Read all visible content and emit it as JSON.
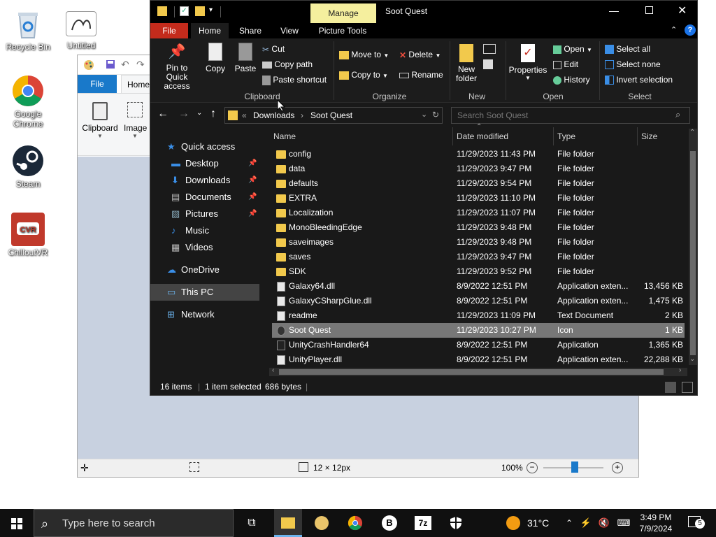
{
  "desktop": {
    "icons": [
      {
        "label": "Recycle Bin"
      },
      {
        "label": "Untitled"
      },
      {
        "label": "Google Chrome"
      },
      {
        "label": "Steam"
      },
      {
        "label": "ChilloutVR"
      }
    ]
  },
  "paint": {
    "tabs": {
      "file": "File",
      "home": "Home"
    },
    "ribbon": {
      "clipboard": "Clipboard",
      "image": "Image"
    },
    "status": {
      "size": "12 × 12px",
      "zoom": "100%"
    }
  },
  "explorer": {
    "title": "Soot Quest",
    "manage_tab": "Manage",
    "tabs": [
      "File",
      "Home",
      "Share",
      "View",
      "Picture Tools"
    ],
    "ribbon": {
      "pin": "Pin to Quick access",
      "copy": "Copy",
      "paste": "Paste",
      "cut": "Cut",
      "copy_path": "Copy path",
      "paste_shortcut": "Paste shortcut",
      "move_to": "Move to",
      "copy_to": "Copy to",
      "delete": "Delete",
      "rename": "Rename",
      "new_folder": "New folder",
      "properties": "Properties",
      "open": "Open",
      "edit": "Edit",
      "history": "History",
      "select_all": "Select all",
      "select_none": "Select none",
      "invert_selection": "Invert selection",
      "groups": [
        "Clipboard",
        "Organize",
        "New",
        "Open",
        "Select"
      ]
    },
    "address": {
      "crumbs": [
        "Downloads",
        "Soot Quest"
      ],
      "search_placeholder": "Search Soot Quest"
    },
    "nav": [
      {
        "label": "Quick access",
        "type": "star"
      },
      {
        "label": "Desktop",
        "type": "desktop",
        "pinned": true
      },
      {
        "label": "Downloads",
        "type": "download",
        "pinned": true
      },
      {
        "label": "Documents",
        "type": "doc",
        "pinned": true
      },
      {
        "label": "Pictures",
        "type": "pic",
        "pinned": true
      },
      {
        "label": "Music",
        "type": "music"
      },
      {
        "label": "Videos",
        "type": "video"
      },
      {
        "label": "OneDrive",
        "type": "cloud"
      },
      {
        "label": "This PC",
        "type": "pc"
      },
      {
        "label": "Network",
        "type": "network"
      }
    ],
    "columns": [
      "Name",
      "Date modified",
      "Type",
      "Size"
    ],
    "files": [
      {
        "name": "config",
        "date": "11/29/2023 11:43 PM",
        "type": "File folder",
        "size": "",
        "kind": "folder"
      },
      {
        "name": "data",
        "date": "11/29/2023 9:47 PM",
        "type": "File folder",
        "size": "",
        "kind": "folder"
      },
      {
        "name": "defaults",
        "date": "11/29/2023 9:54 PM",
        "type": "File folder",
        "size": "",
        "kind": "folder"
      },
      {
        "name": "EXTRA",
        "date": "11/29/2023 11:10 PM",
        "type": "File folder",
        "size": "",
        "kind": "folder"
      },
      {
        "name": "Localization",
        "date": "11/29/2023 11:07 PM",
        "type": "File folder",
        "size": "",
        "kind": "folder"
      },
      {
        "name": "MonoBleedingEdge",
        "date": "11/29/2023 9:48 PM",
        "type": "File folder",
        "size": "",
        "kind": "folder"
      },
      {
        "name": "saveimages",
        "date": "11/29/2023 9:48 PM",
        "type": "File folder",
        "size": "",
        "kind": "folder"
      },
      {
        "name": "saves",
        "date": "11/29/2023 9:47 PM",
        "type": "File folder",
        "size": "",
        "kind": "folder"
      },
      {
        "name": "SDK",
        "date": "11/29/2023 9:52 PM",
        "type": "File folder",
        "size": "",
        "kind": "folder"
      },
      {
        "name": "Galaxy64.dll",
        "date": "8/9/2022 12:51 PM",
        "type": "Application exten...",
        "size": "13,456 KB",
        "kind": "file"
      },
      {
        "name": "GalaxyCSharpGlue.dll",
        "date": "8/9/2022 12:51 PM",
        "type": "Application exten...",
        "size": "1,475 KB",
        "kind": "file"
      },
      {
        "name": "readme",
        "date": "11/29/2023 11:09 PM",
        "type": "Text Document",
        "size": "2 KB",
        "kind": "file"
      },
      {
        "name": "Soot Quest",
        "date": "11/29/2023 10:27 PM",
        "type": "Icon",
        "size": "1 KB",
        "kind": "icon",
        "selected": true
      },
      {
        "name": "UnityCrashHandler64",
        "date": "8/9/2022 12:51 PM",
        "type": "Application",
        "size": "1,365 KB",
        "kind": "app"
      },
      {
        "name": "UnityPlayer.dll",
        "date": "8/9/2022 12:51 PM",
        "type": "Application exten...",
        "size": "22,288 KB",
        "kind": "file"
      }
    ],
    "status": {
      "items": "16 items",
      "selected": "1 item selected",
      "bytes": "686 bytes"
    }
  },
  "taskbar": {
    "search_placeholder": "Type here to search",
    "weather": "31°C",
    "time": "3:49 PM",
    "date": "7/9/2024",
    "notifications": "5",
    "app_7z": "7z",
    "app_b": "B"
  },
  "colors": {
    "accent_red": "#c42b1c",
    "manage_yellow": "#f5ef9e",
    "selection": "#777777"
  }
}
